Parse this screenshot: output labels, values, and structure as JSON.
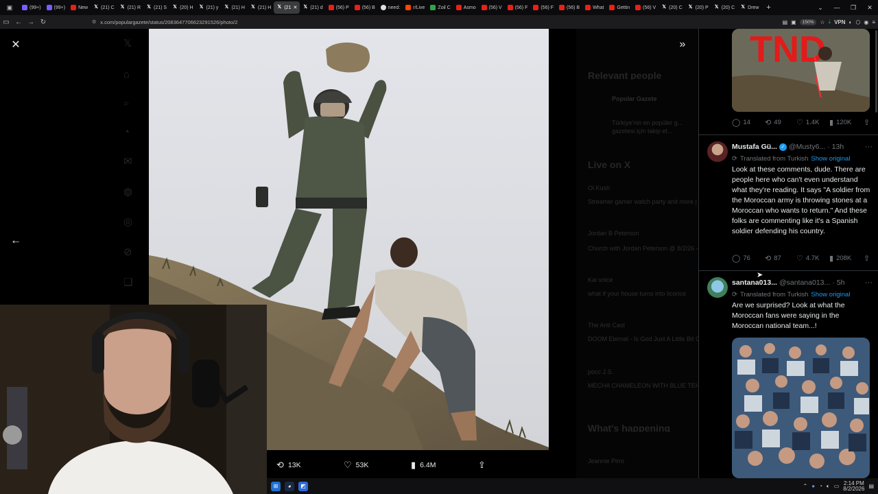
{
  "browser": {
    "tabs": [
      {
        "label": "(99+)",
        "icon": "tw"
      },
      {
        "label": "(99+)",
        "icon": "tw"
      },
      {
        "label": "New",
        "icon": "yt"
      },
      {
        "label": "(21) C",
        "icon": "x"
      },
      {
        "label": "(21) R",
        "icon": "x"
      },
      {
        "label": "(21) S",
        "icon": "x"
      },
      {
        "label": "(20) H",
        "icon": "x"
      },
      {
        "label": "(21) y",
        "icon": "x"
      },
      {
        "label": "(21) H",
        "icon": "x"
      },
      {
        "label": "(21) H",
        "icon": "x"
      },
      {
        "label": "(21",
        "icon": "x",
        "active": true
      },
      {
        "label": "(21) d",
        "icon": "x"
      },
      {
        "label": "(56) P",
        "icon": "yt"
      },
      {
        "label": "(56) B",
        "icon": "yt"
      },
      {
        "label": "need:",
        "icon": "wh"
      },
      {
        "label": "r/Live",
        "icon": "red"
      },
      {
        "label": "Zoil C",
        "icon": "gr"
      },
      {
        "label": "Asmo",
        "icon": "yt"
      },
      {
        "label": "(56) V",
        "icon": "yt"
      },
      {
        "label": "(56) F",
        "icon": "yt"
      },
      {
        "label": "(56) F",
        "icon": "yt"
      },
      {
        "label": "(56) B",
        "icon": "yt"
      },
      {
        "label": "What",
        "icon": "yt"
      },
      {
        "label": "Gettin",
        "icon": "yt"
      },
      {
        "label": "(56) V",
        "icon": "yt"
      },
      {
        "label": "(20) C",
        "icon": "x"
      },
      {
        "label": "(20) P",
        "icon": "x"
      },
      {
        "label": "(20) C",
        "icon": "x"
      },
      {
        "label": "Drew",
        "icon": "x"
      }
    ],
    "url": "x.com/populargazete/status/2083647706623291526/photo/2",
    "zoom": "150%",
    "vpn_label": "VPN"
  },
  "background": {
    "relevant_people_title": "Relevant people",
    "relevant_name": "Popular Gazete",
    "relevant_bio_1": "Türkiye'nin en popüler g...",
    "relevant_bio_2": "gazetesi için takip et...",
    "live_title": "Live on X",
    "live_1_user": "Ol Kush",
    "live_1_text": "Streamer gamer watch party and more | @hop livewatch...",
    "live_2_user": "Jordan B Peterson",
    "live_2_text": "Church with Jordan Peterson @ 8/2/26 — LATE...",
    "live_3_user": "Kai voice",
    "live_3_text": "what if your house turns into licorice",
    "live_4_user": "The Anti Cast",
    "live_4_text": "DOOM Eternal - Is God Just A Little Bit Of A Jerk?",
    "live_5_user": "pocc J.S.",
    "live_5_text": "MECHA CHAMELEON WITH BLUE TEHEES",
    "happening_title": "What's happening",
    "happening_1": "Jeannie Pirro"
  },
  "viewer": {
    "retweets": "13K",
    "likes": "53K",
    "views": "6.4M"
  },
  "replies": {
    "top_stats": {
      "replies": "14",
      "retweets": "49",
      "likes": "1.4K",
      "views": "120K"
    },
    "top_image_text": "TND",
    "items": [
      {
        "name": "Mustafa Gü...",
        "handle": "@Musty6...",
        "time": "13h",
        "translated": "Translated from Turkish",
        "show_original": "Show original",
        "text": "Look at these comments, dude. There are people here who can't even understand what they're reading. It says \"A soldier from the Moroccan army is throwing stones at a Moroccan who wants to return.\" And these folks are commenting like it's a Spanish soldier defending his country.",
        "stats": {
          "replies": "76",
          "retweets": "87",
          "likes": "4.7K",
          "views": "208K"
        }
      },
      {
        "name": "santana013...",
        "handle": "@santana013...",
        "time": "5h",
        "translated": "Translated from Turkish",
        "show_original": "Show original",
        "text": "Are we surprised? Look at what the Moroccan fans were saying in the Moroccan national team...!"
      }
    ]
  },
  "taskbar": {
    "time": "2:14 PM",
    "date": "8/2/2026"
  },
  "colors": {
    "accent": "#1d9bf0",
    "muted": "#71767b",
    "text": "#e7e9ea"
  }
}
